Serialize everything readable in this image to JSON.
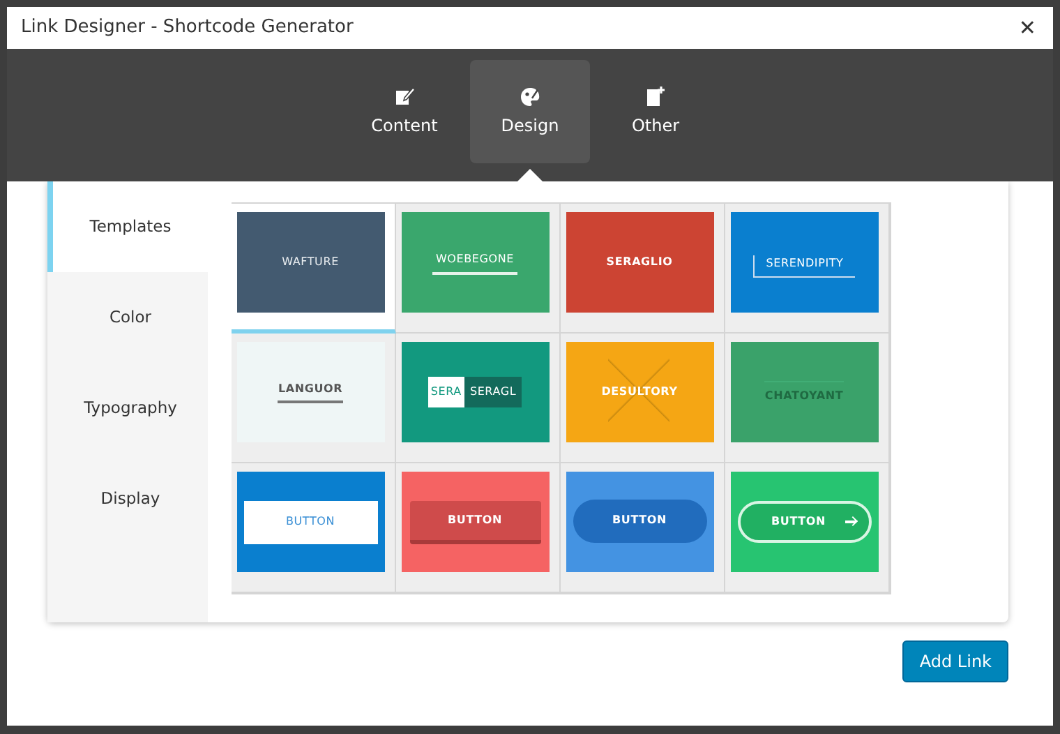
{
  "window": {
    "title": "Link Designer - Shortcode Generator",
    "close": "✕"
  },
  "tabs": [
    {
      "label": "Content",
      "kind": "note",
      "selected": false
    },
    {
      "label": "Design",
      "kind": "palette",
      "selected": true
    },
    {
      "label": "Other",
      "kind": "doc-plus",
      "selected": false
    }
  ],
  "sidebar": {
    "items": [
      {
        "label": "Templates",
        "selected": true
      },
      {
        "label": "Color",
        "selected": false
      },
      {
        "label": "Typography",
        "selected": false
      },
      {
        "label": "Display",
        "selected": false
      }
    ]
  },
  "templates": [
    {
      "label": "WAFTURE",
      "kind": "plain",
      "color": "#435a70",
      "selected": true
    },
    {
      "label": "WOEBEGONE",
      "kind": "underline",
      "color": "#3aa76d",
      "selected": false
    },
    {
      "label": "SERAGLIO",
      "kind": "bold",
      "color": "#cc4433",
      "selected": false
    },
    {
      "label": "SERENDIPITY",
      "kind": "bracket",
      "color": "#0a7fcf",
      "selected": false
    },
    {
      "label": "LANGUOR",
      "kind": "light",
      "color": "#eff6f6",
      "selected": false
    },
    {
      "label": "SERAGL",
      "label_2": "SERA",
      "kind": "split",
      "color": "#12997f",
      "selected": false
    },
    {
      "label": "DESULTORY",
      "kind": "cross",
      "color": "#f5a614",
      "selected": false
    },
    {
      "label": "CHATOYANT",
      "kind": "faded",
      "color": "#3aa26a",
      "selected": false
    },
    {
      "label": "BUTTON",
      "kind": "box-button",
      "color": "#0a7fcf",
      "selected": false
    },
    {
      "label": "BUTTON",
      "kind": "raised-button",
      "color": "#f56363",
      "selected": false
    },
    {
      "label": "BUTTON",
      "kind": "pill-button",
      "color": "#4493e2",
      "selected": false
    },
    {
      "label": "BUTTON",
      "kind": "arrow-button",
      "color": "#27c471",
      "selected": false
    }
  ],
  "buttons": [
    {
      "label": "Add Link"
    }
  ]
}
